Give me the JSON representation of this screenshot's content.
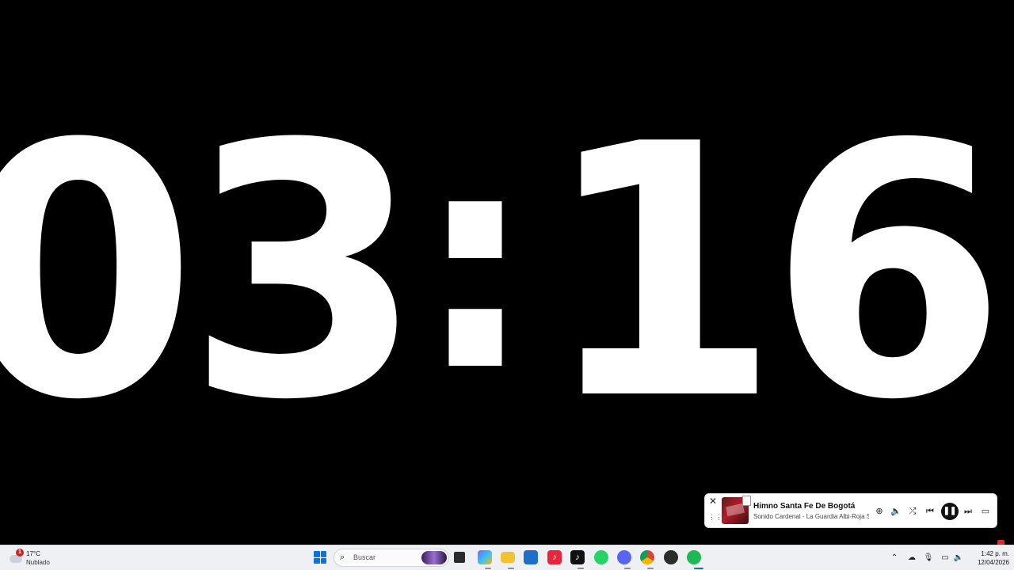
{
  "timer": {
    "d1": "0",
    "d2": "3",
    "sep": ":",
    "d3": "1",
    "d4": "6"
  },
  "media_player": {
    "close_glyph": "✕",
    "title": "Himno Santa Fe De Bogotá",
    "artist": "Sonido Cardenal - La Guardia Albi-Roja Sur",
    "controls": {
      "add": "⊕",
      "volume": "🔈",
      "shuffle": "⤮",
      "previous": "⏮",
      "pause": "❚❚",
      "next": "⏭",
      "miniplayer": "▭"
    }
  },
  "taskbar": {
    "weather": {
      "temperature": "17°C",
      "condition": "Nublado",
      "badge": "1"
    },
    "search": {
      "placeholder": "Buscar"
    },
    "apps": [
      {
        "name": "task-view",
        "color": "#2b2b2b"
      },
      {
        "name": "copilot",
        "color": "#7b61ff"
      },
      {
        "name": "file-explorer",
        "color": "#f2c230"
      },
      {
        "name": "microsoft-store",
        "color": "#1f6fc8"
      },
      {
        "name": "tiktok-red",
        "color": "#e8253a"
      },
      {
        "name": "tiktok",
        "color": "#111111"
      },
      {
        "name": "whatsapp",
        "color": "#25d366"
      },
      {
        "name": "discord",
        "color": "#5865f2"
      },
      {
        "name": "chrome",
        "color": "#db4437"
      },
      {
        "name": "app-dark",
        "color": "#2c2c2c"
      },
      {
        "name": "spotify",
        "color": "#1db954"
      }
    ],
    "tray": {
      "chevron": "⌃",
      "clock_time": "1:42 p. m.",
      "clock_date": "12/04/2026"
    }
  },
  "colors": {
    "background": "#000000",
    "timer_digits": "#ffffff",
    "taskbar": "#eef0f3",
    "accent": "#0a74da"
  }
}
